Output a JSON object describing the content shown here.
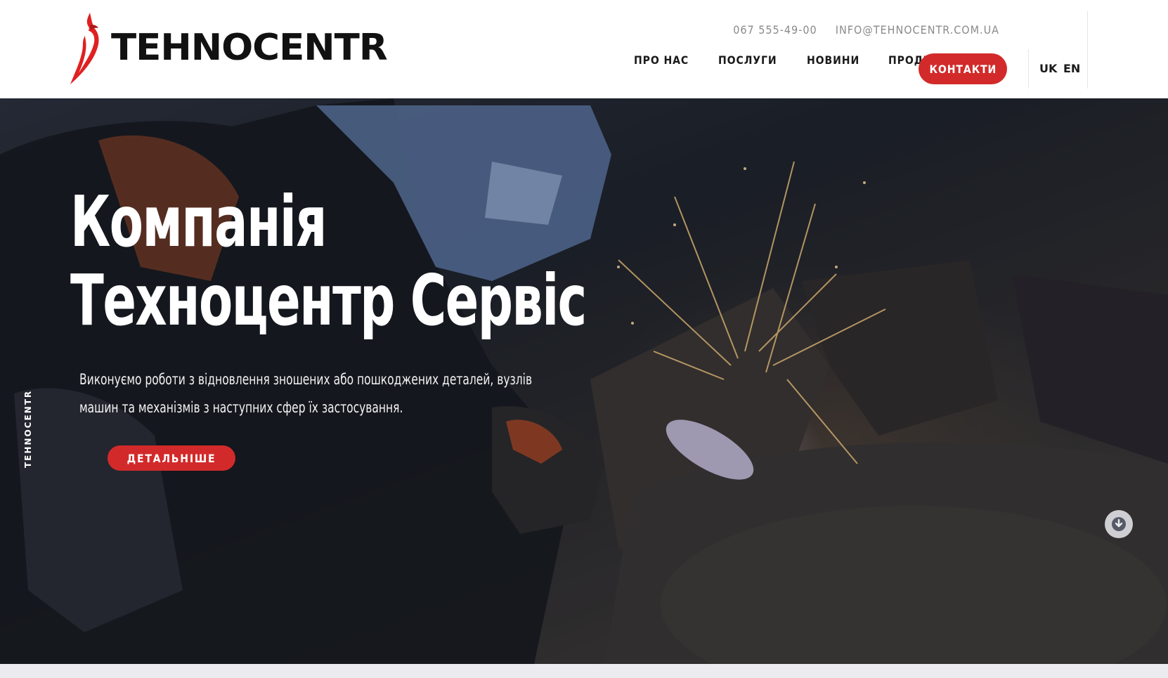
{
  "header": {
    "logo_text": "TEHNOCENTR",
    "phone": "067 555-49-00",
    "email": "INFO@TEHNOCENTR.COM.UA",
    "nav": [
      {
        "label": "ПРО НАС"
      },
      {
        "label": "ПОСЛУГИ"
      },
      {
        "label": "НОВИНИ"
      },
      {
        "label": "ПРОДУКЦІЯ"
      }
    ],
    "cta_label": "КОНТАКТИ",
    "languages": [
      "UK",
      "EN"
    ]
  },
  "hero": {
    "side_tag": "TEHNOCENTR",
    "title_line1": "Компанія",
    "title_line2": "Техноцентр Сервіс",
    "subtitle": "Виконуємо роботи з відновлення зношених або пошкоджених деталей, вузлів машин та механізмів з наступних сфер їх застосування.",
    "button_label": "ДЕТАЛЬНІШЕ",
    "scroll_icon": "arrow-down-circle-icon"
  },
  "colors": {
    "accent": "#d22a2a",
    "text_dark": "#1a1a1a",
    "muted": "#8a8a8a"
  }
}
